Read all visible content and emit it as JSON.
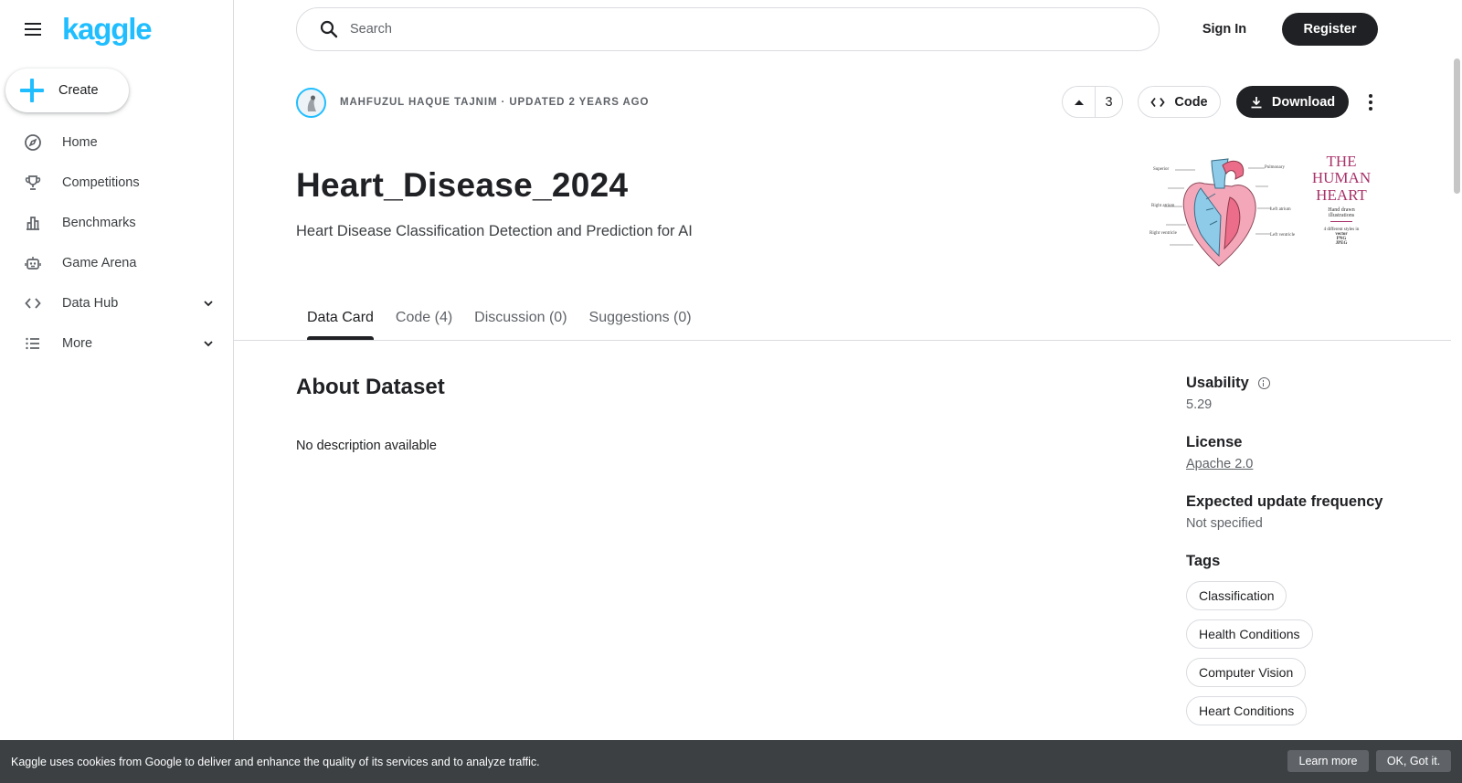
{
  "sidebar": {
    "logo": "kaggle",
    "create_label": "Create",
    "items": [
      {
        "label": "Home",
        "icon": "compass-icon"
      },
      {
        "label": "Competitions",
        "icon": "trophy-icon"
      },
      {
        "label": "Benchmarks",
        "icon": "bar-chart-icon"
      },
      {
        "label": "Game Arena",
        "icon": "robot-icon"
      },
      {
        "label": "Data Hub",
        "icon": "code-icon"
      },
      {
        "label": "More",
        "icon": "list-icon"
      }
    ]
  },
  "header": {
    "search_placeholder": "Search",
    "sign_in": "Sign In",
    "register": "Register"
  },
  "dataset": {
    "byline": "MAHFUZUL HAQUE TAJNIM · UPDATED 2 YEARS AGO",
    "vote_count": "3",
    "code_label": "Code",
    "download_label": "Download",
    "title": "Heart_Disease_2024",
    "subtitle": "Heart Disease Classification Detection and Prediction for AI",
    "cover_text": {
      "line1": "THE",
      "line2": "HUMAN",
      "line3": "HEART",
      "line4": "Hand drawn",
      "line5": "illustrations",
      "line6": "4 different styles in",
      "line7": "vector",
      "line8": "PNG",
      "line9": "JPEG"
    }
  },
  "tabs": [
    {
      "label": "Data Card",
      "active": true
    },
    {
      "label": "Code (4)",
      "active": false
    },
    {
      "label": "Discussion (0)",
      "active": false
    },
    {
      "label": "Suggestions (0)",
      "active": false
    }
  ],
  "content": {
    "about_title": "About Dataset",
    "description": "No description available"
  },
  "meta": {
    "usability_label": "Usability",
    "usability_value": "5.29",
    "license_label": "License",
    "license_value": "Apache 2.0",
    "frequency_label": "Expected update frequency",
    "frequency_value": "Not specified",
    "tags_label": "Tags",
    "tags": [
      "Classification",
      "Health Conditions",
      "Computer Vision",
      "Heart Conditions"
    ]
  },
  "cookie": {
    "text": "Kaggle uses cookies from Google to deliver and enhance the quality of its services and to analyze traffic.",
    "learn_more": "Learn more",
    "ok": "OK, Got it."
  },
  "colors": {
    "brand": "#20beff",
    "dark": "#202124",
    "cookie_bg": "#3c4043"
  }
}
